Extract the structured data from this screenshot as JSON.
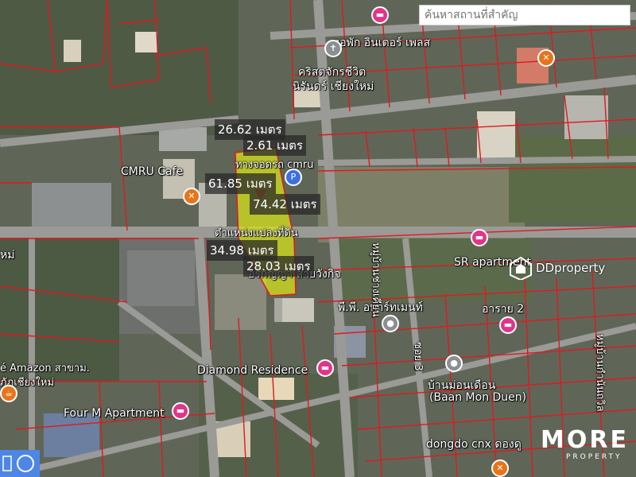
{
  "search": {
    "placeholder": "ค้นหาสถานที่สำคัญ"
  },
  "places": {
    "top_place": "หอพัก อินเตอร์ เพลส",
    "church_line1": "คริสตจักรชีวิต",
    "church_line2": "นิรันดร์ เชียงใหม่",
    "cmru_cafe": "CMRU Cafe",
    "cmru_parking": "ทางจอดรถ cmru",
    "plot_label": "ตำแหน่งแปลงที่ดิน",
    "sr_apartment": "SR apartment",
    "ornanya": "อรกัญญา สายวังกิจ",
    "pp_apartment": "พี.พี. อพาร์ทเมนท์",
    "arai": "อาราย 2",
    "amazon_line1": "é Amazon สาขาม.",
    "amazon_line2": "ภัฏเชียงใหม่",
    "left_edge": "หม่",
    "diamond": "Diamond Residence",
    "four_m": "Four M Apartment",
    "ban_mon_duen_th": "บ้านม่อนเดือน",
    "ban_mon_duen_en": "(Baan Mon Duen)",
    "dongdo": "dongdo cnx ดองดู",
    "road_side_1": "หมู่บ้านช่างเคียน",
    "road_side_2": "ซอย 3",
    "road_side_3": "หมู่บ้านกำนันถวิล"
  },
  "measurements": {
    "m1": "26.62 เมตร",
    "m2": "2.61 เมตร",
    "m3": "61.85 เมตร",
    "m4": "74.42 เมตร",
    "m5": "34.98 เมตร",
    "m6": "28.03 เมตร"
  },
  "watermarks": {
    "ddproperty": "DDproperty",
    "more": "MORE",
    "more_sub": "PROPERTY"
  },
  "colors": {
    "plot_fill": "#d6e21c",
    "parcel_line": "#e0191f",
    "road": "#9a9a96",
    "pin_pink": "#e0358a",
    "pin_orange": "#e8741a"
  }
}
